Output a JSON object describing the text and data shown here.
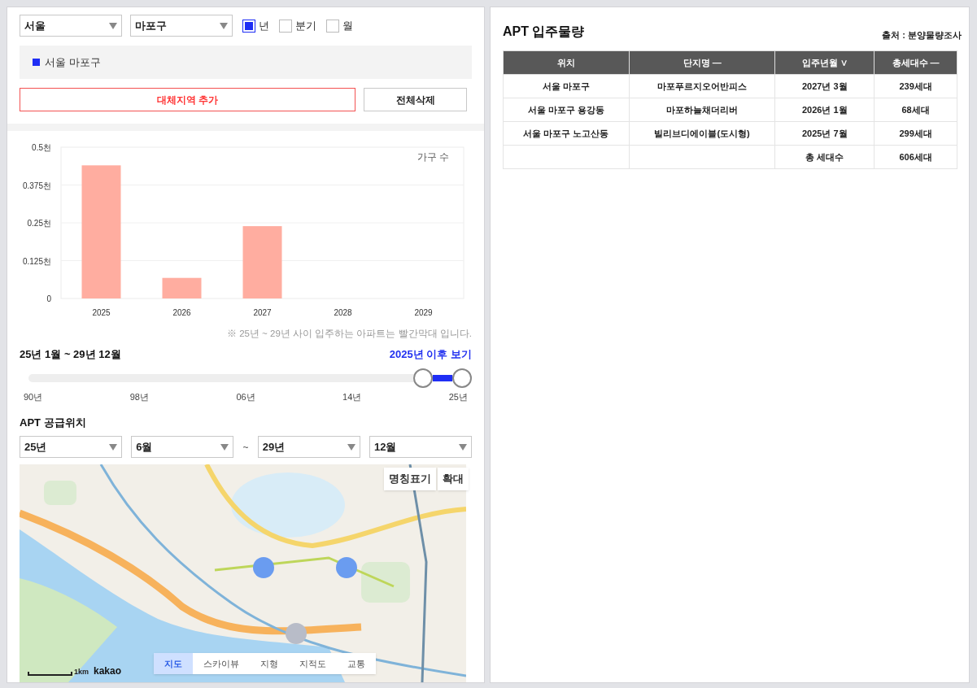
{
  "filters": {
    "region_select": "서울",
    "district_select": "마포구",
    "periods": [
      {
        "label": "년",
        "checked": true
      },
      {
        "label": "분기",
        "checked": false
      },
      {
        "label": "월",
        "checked": false
      }
    ]
  },
  "legend": [
    {
      "label": "서울 마포구",
      "color": "#1f2ef5"
    }
  ],
  "buttons": {
    "add": "대체지역 추가",
    "clear": "전체삭제"
  },
  "chart": {
    "chart_data": {
      "type": "bar",
      "grid": true,
      "categories": [
        "2025",
        "2026",
        "2027",
        "2028",
        "2029"
      ],
      "series": [
        {
          "name": "가구 수",
          "color": "#ffada0",
          "values": [
            0.44,
            0.068,
            0.239,
            0,
            0
          ]
        }
      ],
      "ylim": [
        0,
        0.5
      ],
      "yticks": [
        {
          "value": 0,
          "label": "0"
        },
        {
          "value": 0.125,
          "label": "0.125천"
        },
        {
          "value": 0.25,
          "label": "0.25천"
        },
        {
          "value": 0.375,
          "label": "0.375천"
        },
        {
          "value": 0.5,
          "label": "0.5천"
        }
      ]
    },
    "note": "※ 25년 ~ 29년 사이 입주하는 아파트는 빨간막대 입니다."
  },
  "range": {
    "label": "25년 1월 ~ 29년 12월",
    "link": "2025년 이후 보기",
    "thumbs": [
      {
        "level": 0.91
      },
      {
        "level": 1
      }
    ],
    "ticks": [
      "90년",
      "98년",
      "06년",
      "14년",
      "25년"
    ]
  },
  "supply": {
    "title": "APT 공급위치",
    "selects": [
      {
        "value": "25년"
      },
      {
        "value": "6월"
      },
      {
        "kind": "separator",
        "text": "~"
      },
      {
        "value": "29년"
      },
      {
        "value": "12월"
      }
    ],
    "map": {
      "kind": "picture",
      "overlay_buttons": [
        "명칭표기",
        "확대"
      ],
      "map_types": [
        {
          "label": "지도",
          "selected": true
        },
        {
          "label": "스카이뷰",
          "selected": false
        },
        {
          "label": "지형",
          "selected": false
        },
        {
          "label": "지적도",
          "selected": false
        },
        {
          "label": "교통",
          "selected": false
        }
      ],
      "scale": "1km",
      "attribution": "kakao"
    }
  },
  "table": {
    "title": "APT 입주물량",
    "source": "출처 : 분양물량조사",
    "columns": [
      "위치",
      "단지명 —",
      "입주년월 ∨",
      "총세대수 —"
    ],
    "rows": [
      [
        "서울 마포구",
        "마포푸르지오어반피스",
        "2027년 3월",
        "239세대"
      ],
      [
        "서울 마포구 용강동",
        "마포하늘채더리버",
        "2026년 1월",
        "68세대"
      ],
      [
        "서울 마포구 노고산동",
        "빌리브디에이블(도시형)",
        "2025년 7월",
        "299세대"
      ],
      [
        "",
        "",
        "총 세대수",
        "606세대"
      ]
    ]
  }
}
